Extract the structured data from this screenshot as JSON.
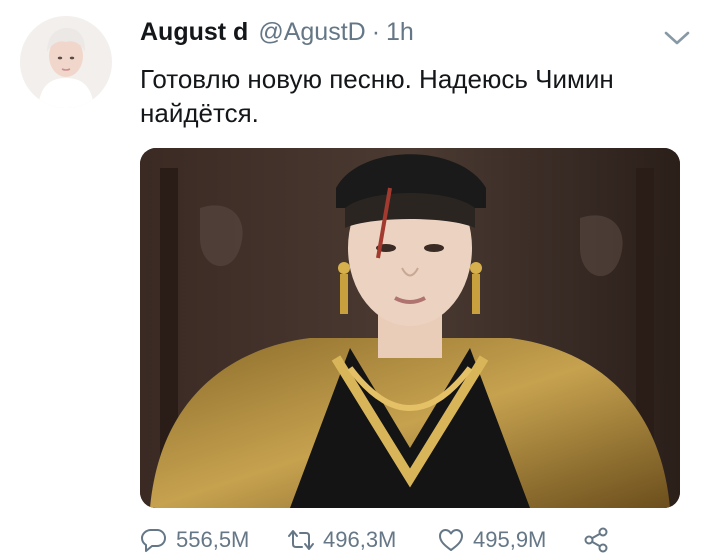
{
  "tweet": {
    "author_name": "August d",
    "handle": "@AgustD",
    "separator": "·",
    "time": "1h",
    "text": "Готовлю новую песню. Надеюсь Чимин\nнайдётся.",
    "media_icon": "photo",
    "avatar_icon": "profile-avatar",
    "menu_icon": "chevron-down-icon",
    "actions": {
      "replies": "556,5M",
      "retweets": "496,3M",
      "likes": "495,9M"
    },
    "colors": {
      "text": "#14171a",
      "secondary": "#657786"
    }
  }
}
